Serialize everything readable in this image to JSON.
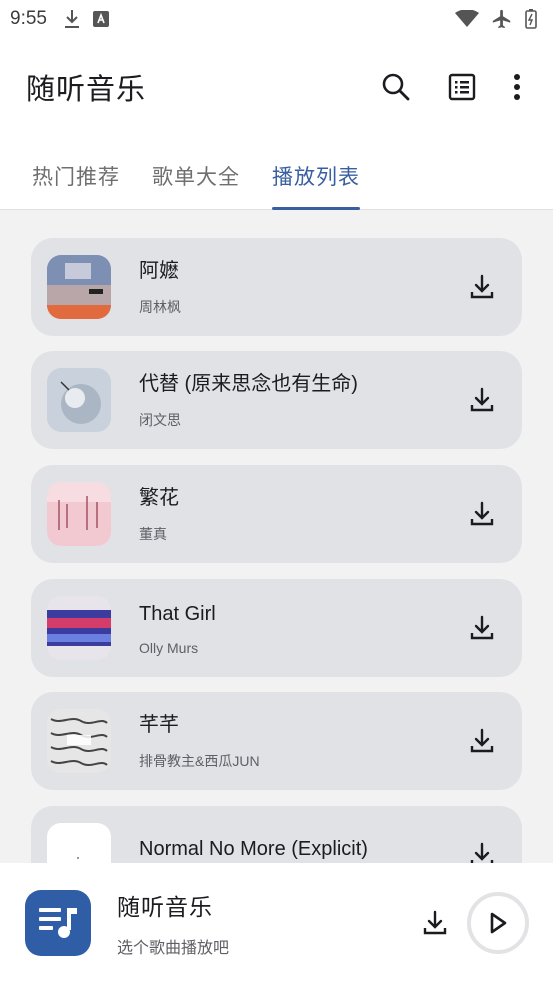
{
  "status": {
    "time": "9:55"
  },
  "app": {
    "title": "随听音乐"
  },
  "tabs": [
    {
      "label": "热门推荐"
    },
    {
      "label": "歌单大全"
    },
    {
      "label": "播放列表"
    }
  ],
  "songs": [
    {
      "title": "阿嬷",
      "artist": "周林枫"
    },
    {
      "title": "代替 (原来思念也有生命)",
      "artist": "闭文思"
    },
    {
      "title": "繁花",
      "artist": "董真"
    },
    {
      "title": "That Girl",
      "artist": "Olly Murs"
    },
    {
      "title": "芊芊",
      "artist": "排骨教主&西瓜JUN"
    },
    {
      "title": "Normal No More (Explicit)",
      "artist": ""
    }
  ],
  "player": {
    "title": "随听音乐",
    "subtitle": "选个歌曲播放吧"
  },
  "colors": {
    "accent": "#3a5fa0",
    "card": "#e1e2e5",
    "list_bg": "#f2f2f3",
    "player_art": "#2f5ea6"
  },
  "icons": {
    "search": "search-icon",
    "list": "list-icon",
    "more": "more-vert-icon",
    "download": "download-icon",
    "play": "play-icon",
    "music_queue": "music-queue-icon"
  }
}
